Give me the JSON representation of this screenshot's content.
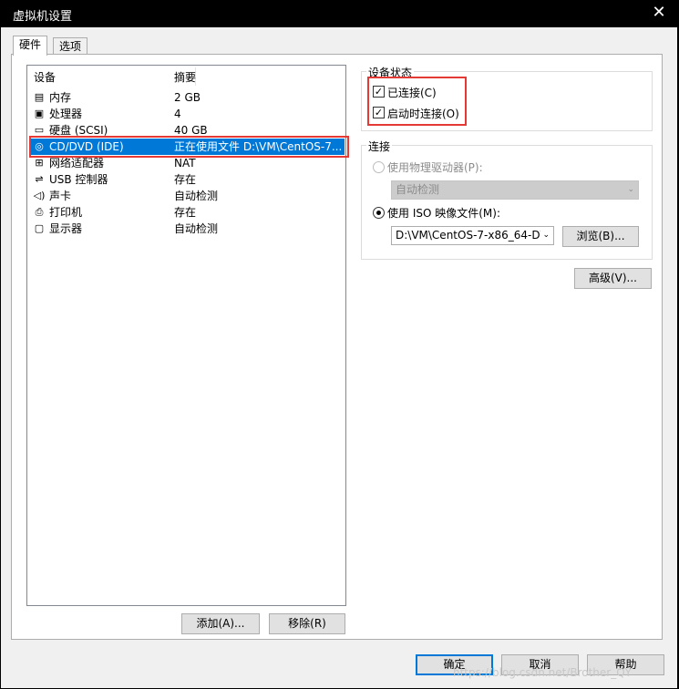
{
  "window": {
    "title": "虚拟机设置"
  },
  "tabs": [
    {
      "label": "硬件"
    },
    {
      "label": "选项"
    }
  ],
  "device_list": {
    "headers": {
      "device": "设备",
      "summary": "摘要"
    },
    "rows": [
      {
        "name": "内存",
        "summary": "2 GB",
        "icon": "memory-icon"
      },
      {
        "name": "处理器",
        "summary": "4",
        "icon": "cpu-icon"
      },
      {
        "name": "硬盘 (SCSI)",
        "summary": "40 GB",
        "icon": "harddisk-icon"
      },
      {
        "name": "CD/DVD (IDE)",
        "summary": "正在使用文件 D:\\VM\\CentOS-7...",
        "icon": "cd-icon"
      },
      {
        "name": "网络适配器",
        "summary": "NAT",
        "icon": "network-icon"
      },
      {
        "name": "USB 控制器",
        "summary": "存在",
        "icon": "usb-icon"
      },
      {
        "name": "声卡",
        "summary": "自动检测",
        "icon": "sound-icon"
      },
      {
        "name": "打印机",
        "summary": "存在",
        "icon": "printer-icon"
      },
      {
        "name": "显示器",
        "summary": "自动检测",
        "icon": "display-icon"
      }
    ],
    "selected_index": 3
  },
  "buttons": {
    "add": "添加(A)...",
    "remove": "移除(R)",
    "advanced": "高级(V)...",
    "ok": "确定",
    "cancel": "取消",
    "help": "帮助",
    "browse": "浏览(B)..."
  },
  "device_status": {
    "title": "设备状态",
    "connected": {
      "label": "已连接(C)",
      "checked": true
    },
    "connect_at_power_on": {
      "label": "启动时连接(O)",
      "checked": true
    }
  },
  "connection": {
    "title": "连接",
    "physical_drive": {
      "label": "使用物理驱动器(P):",
      "selected": false,
      "value": "自动检测"
    },
    "iso_image": {
      "label": "使用 ISO 映像文件(M):",
      "selected": true,
      "value": "D:\\VM\\CentOS-7-x86_64-D\\"
    }
  },
  "watermark": "https://blog.csdn.net/Brother_QY",
  "colors": {
    "selection": "#0078d7",
    "highlight_box": "#e53935"
  }
}
